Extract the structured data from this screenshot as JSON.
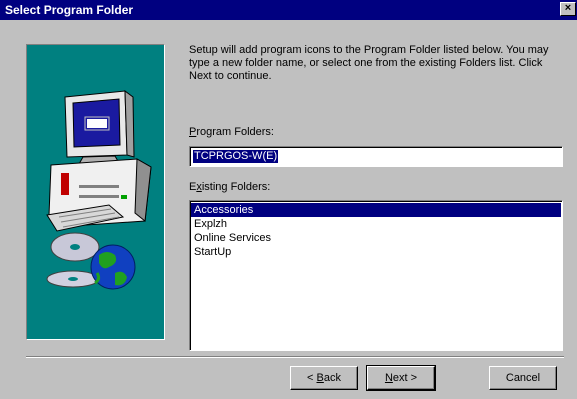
{
  "window": {
    "title": "Select Program Folder",
    "close_glyph": "×"
  },
  "intro_text": "Setup will add program icons to the Program Folder listed below.  You may type a new folder name, or select one from the existing Folders list.  Click Next to continue.",
  "program_folders": {
    "label_underlined": "P",
    "label_rest": "rogram Folders:",
    "value": "TCPRGOS-W(E)"
  },
  "existing_folders": {
    "label_first": "E",
    "label_underlined": "x",
    "label_rest": "isting Folders:",
    "items": [
      "Accessories",
      "Explzh",
      "Online Services",
      "StartUp"
    ],
    "selected_index": 0
  },
  "buttons": {
    "back_prefix": "< ",
    "back_underlined": "B",
    "back_rest": "ack",
    "next_underlined": "N",
    "next_rest": "ext >",
    "cancel": "Cancel"
  },
  "colors": {
    "titlebar": "#000080",
    "art_background": "#008080",
    "selection": "#000080"
  },
  "icons": {
    "art": "computer-with-globe-and-cds-illustration"
  }
}
